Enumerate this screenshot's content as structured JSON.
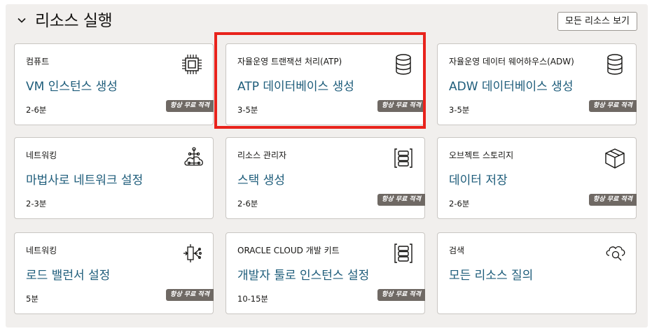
{
  "header": {
    "title": "리소스 실행",
    "view_all_label": "모든 리소스 보기"
  },
  "badge_label": "항상 무료 적격",
  "cards": [
    {
      "category": "컴퓨트",
      "action": "VM 인스턴스 생성",
      "duration": "2-6분",
      "icon": "chip-icon",
      "badge": true
    },
    {
      "category": "자율운영 트랜잭션 처리(ATP)",
      "action": "ATP 데이터베이스 생성",
      "duration": "3-5분",
      "icon": "database-icon",
      "badge": true
    },
    {
      "category": "자율운영 데이터 웨어하우스(ADW)",
      "action": "ADW 데이터베이스 생성",
      "duration": "3-5분",
      "icon": "database-icon",
      "badge": true
    },
    {
      "category": "네트워킹",
      "action": "마법사로 네트워크 설정",
      "duration": "2-3분",
      "icon": "network-cloud-icon",
      "badge": false
    },
    {
      "category": "리소스 관리자",
      "action": "스택 생성",
      "duration": "2-6분",
      "icon": "stack-icon",
      "badge": true
    },
    {
      "category": "오브젝트 스토리지",
      "action": "데이터 저장",
      "duration": "2-6분",
      "icon": "box-icon",
      "badge": true
    },
    {
      "category": "네트워킹",
      "action": "로드 밸런서 설정",
      "duration": "5분",
      "icon": "load-balancer-icon",
      "badge": true
    },
    {
      "category": "ORACLE CLOUD 개발 키트",
      "action": "개발자 툴로 인스턴스 설정",
      "duration": "10-15분",
      "icon": "stack-icon",
      "badge": true
    },
    {
      "category": "검색",
      "action": "모든 리소스 질의",
      "duration": "",
      "icon": "cloud-search-icon",
      "badge": false
    }
  ],
  "colors": {
    "link": "#1d5c7a",
    "badge_bg": "#6f6964",
    "highlight": "#e8231c",
    "panel_bg": "#f1efed"
  }
}
